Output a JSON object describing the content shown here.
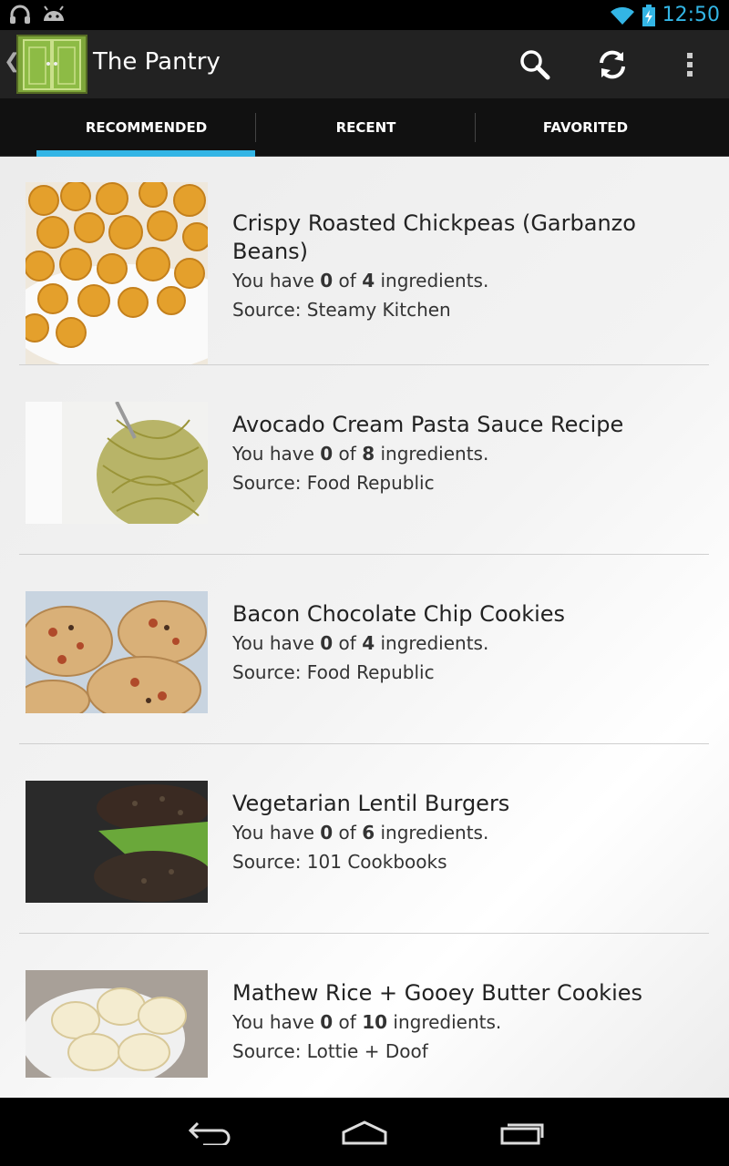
{
  "status": {
    "time": "12:50"
  },
  "action_bar": {
    "title": "The Pantry"
  },
  "tabs": [
    {
      "label": "RECOMMENDED"
    },
    {
      "label": "RECENT"
    },
    {
      "label": "FAVORITED"
    }
  ],
  "recipes": [
    {
      "title": "Crispy Roasted Chickpeas (Garbanzo Beans)",
      "have_prefix": "You have ",
      "have": "0",
      "of": " of ",
      "total": "4",
      "suffix": " ingredients.",
      "source": "Source: Steamy Kitchen"
    },
    {
      "title": "Avocado Cream Pasta Sauce Recipe",
      "have_prefix": "You have ",
      "have": "0",
      "of": " of ",
      "total": "8",
      "suffix": " ingredients.",
      "source": "Source: Food Republic"
    },
    {
      "title": "Bacon Chocolate Chip Cookies",
      "have_prefix": "You have ",
      "have": "0",
      "of": " of ",
      "total": "4",
      "suffix": " ingredients.",
      "source": "Source: Food Republic"
    },
    {
      "title": "Vegetarian Lentil Burgers",
      "have_prefix": "You have ",
      "have": "0",
      "of": " of ",
      "total": "6",
      "suffix": " ingredients.",
      "source": "Source: 101 Cookbooks"
    },
    {
      "title": "Mathew Rice + Gooey Butter Cookies",
      "have_prefix": "You have ",
      "have": "0",
      "of": " of ",
      "total": "10",
      "suffix": " ingredients.",
      "source": "Source: Lottie + Doof"
    }
  ],
  "icons": {
    "status": [
      "headphones-icon",
      "android-icon",
      "wifi-icon",
      "battery-charging-icon"
    ],
    "action_bar": [
      "search-icon",
      "refresh-icon",
      "overflow-menu-icon"
    ],
    "nav": [
      "back-icon",
      "home-icon",
      "recent-apps-icon"
    ]
  },
  "colors": {
    "accent": "#33b5e5"
  }
}
